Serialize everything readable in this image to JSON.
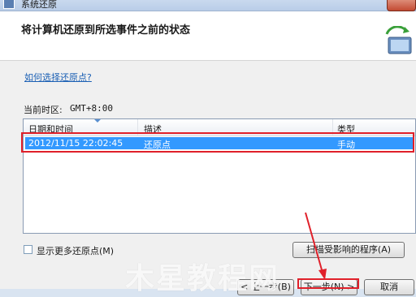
{
  "window": {
    "title": "系统还原"
  },
  "header": {
    "title": "将计算机还原到所选事件之前的状态"
  },
  "help_link": "如何选择还原点?",
  "timezone": {
    "label": "当前时区:",
    "value": "GMT+8:00"
  },
  "table": {
    "columns": [
      "日期和时间",
      "描述",
      "类型"
    ],
    "rows": [
      {
        "datetime": "2012/11/15 22:02:45",
        "description": "还原点",
        "type": "手动",
        "selected": true
      }
    ]
  },
  "show_more_checkbox": {
    "label": "显示更多还原点(M)",
    "checked": false
  },
  "scan_button": "扫描受影响的程序(A)",
  "buttons": {
    "back": "< 上一步(B)",
    "next": "下一步(N) >",
    "cancel": "取消"
  },
  "watermark": "木星教程网",
  "colors": {
    "selection": "#3399ff",
    "highlight_box": "#e0202a",
    "link": "#1a5fb4"
  }
}
